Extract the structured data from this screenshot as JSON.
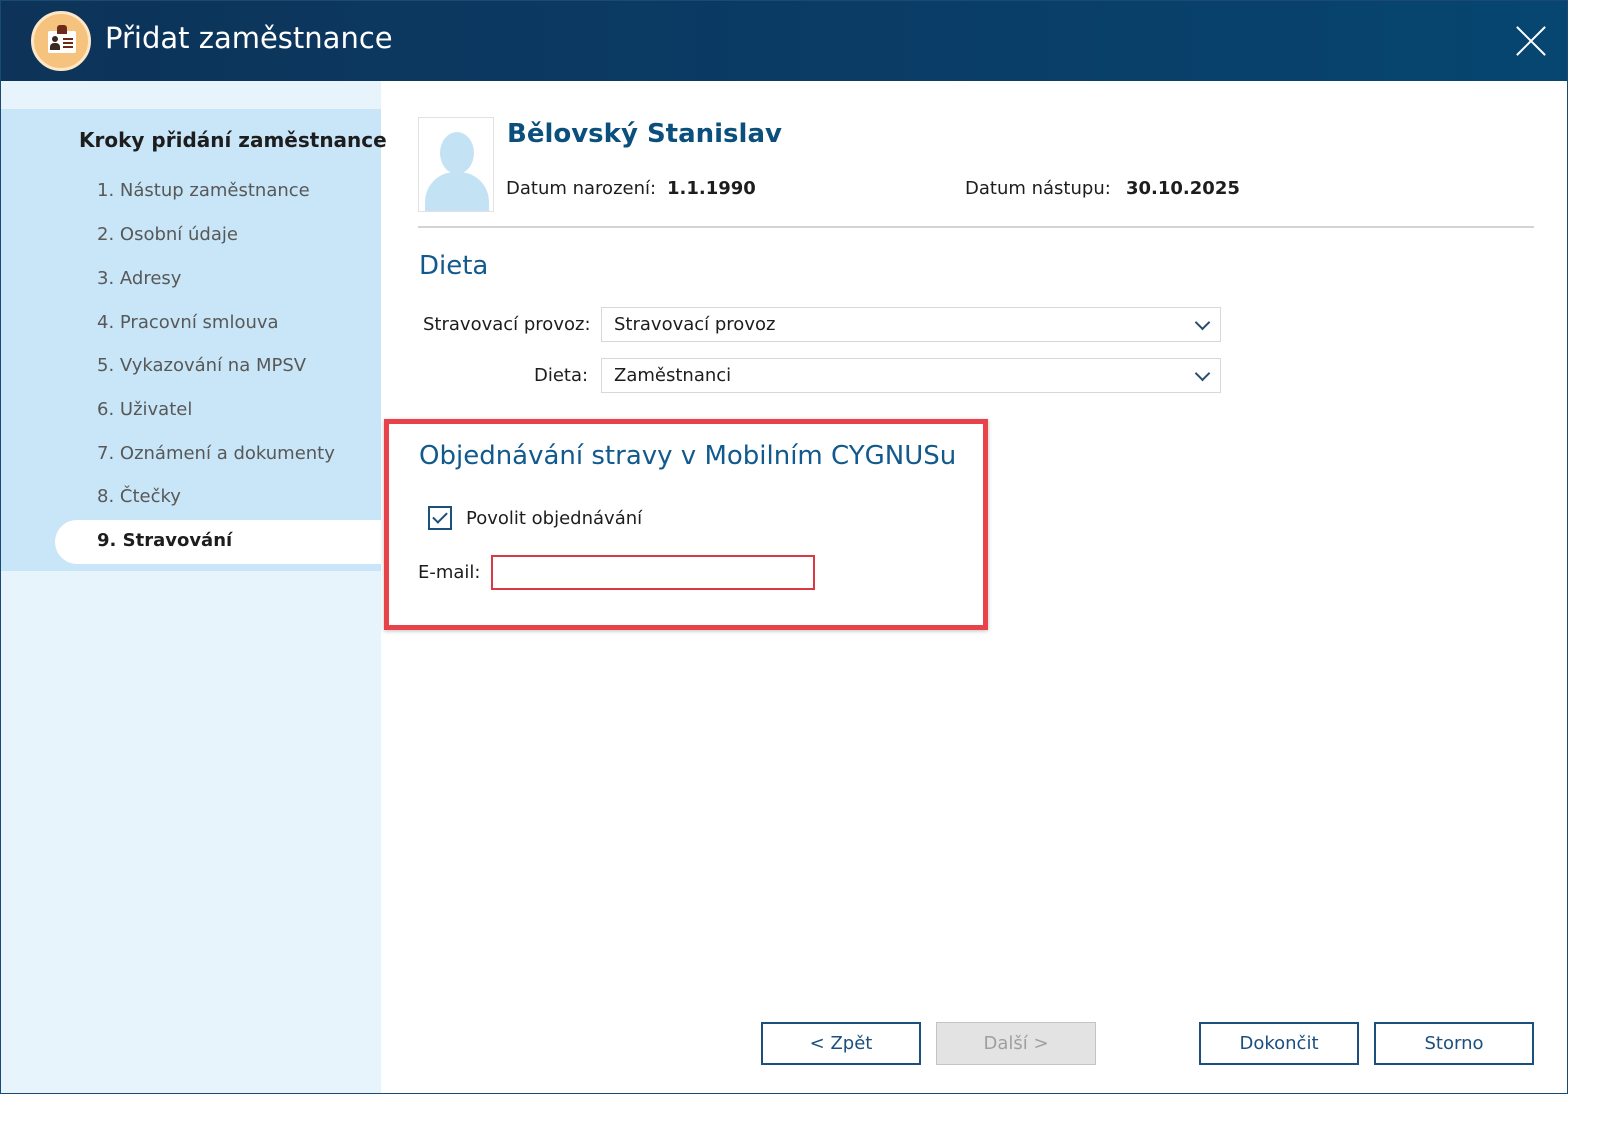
{
  "window": {
    "title": "Přidat zaměstnance"
  },
  "sidebar": {
    "heading": "Kroky přidání zaměstnance",
    "steps": [
      {
        "label": "1. Nástup zaměstnance"
      },
      {
        "label": "2. Osobní údaje"
      },
      {
        "label": "3. Adresy"
      },
      {
        "label": "4. Pracovní smlouva"
      },
      {
        "label": "5. Vykazování na MPSV"
      },
      {
        "label": "6. Uživatel"
      },
      {
        "label": "7. Oznámení a dokumenty"
      },
      {
        "label": "8. Čtečky"
      },
      {
        "label": "9. Stravování",
        "active": true
      }
    ]
  },
  "employee": {
    "name": "Bělovský Stanislav",
    "birth_label": "Datum narození:",
    "birth_value": "1.1.1990",
    "start_label": "Datum nástupu:",
    "start_value": "30.10.2025"
  },
  "diet": {
    "title": "Dieta",
    "canteen_label": "Stravovací provoz:",
    "canteen_value": "Stravovací provoz",
    "diet_label": "Dieta:",
    "diet_value": "Zaměstnanci"
  },
  "mobile": {
    "title": "Objednávání stravy v Mobilním CYGNUSu",
    "allow_label": "Povolit objednávání",
    "allow_checked": true,
    "email_label": "E-mail:",
    "email_value": ""
  },
  "buttons": {
    "back": "< Zpět",
    "next": "Další >",
    "finish": "Dokončit",
    "cancel": "Storno"
  },
  "colors": {
    "titlebar": "#0a3c66",
    "accent": "#12598e",
    "highlight_border": "#e8424a",
    "sidebar_panel": "#c8e6f7"
  },
  "icons": {
    "app": "clipboard-person-icon",
    "close": "close-icon",
    "avatar": "person-placeholder-icon",
    "dropdown": "chevron-down-icon",
    "checkbox": "checkmark-icon"
  }
}
